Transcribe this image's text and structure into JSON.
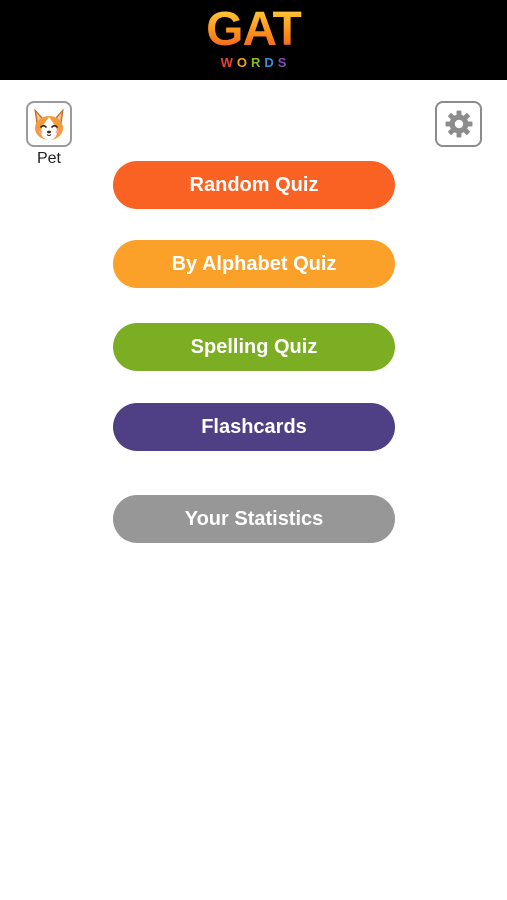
{
  "header": {
    "logo_main": "GAT",
    "logo_sub_letters": [
      "W",
      "O",
      "R",
      "D",
      "S"
    ]
  },
  "toolbar": {
    "pet_label": "Pet",
    "pet_icon": "corgi-face-icon",
    "settings_icon": "gear-icon"
  },
  "menu": {
    "random_quiz": "Random Quiz",
    "alphabet_quiz": "By Alphabet Quiz",
    "spelling_quiz": "Spelling Quiz",
    "flashcards": "Flashcards",
    "statistics": "Your Statistics"
  },
  "colors": {
    "random_quiz": "#f96223",
    "alphabet_quiz": "#fba12a",
    "spelling_quiz": "#7cae24",
    "flashcards": "#4f4086",
    "statistics": "#979797",
    "header_bg": "#000000"
  }
}
